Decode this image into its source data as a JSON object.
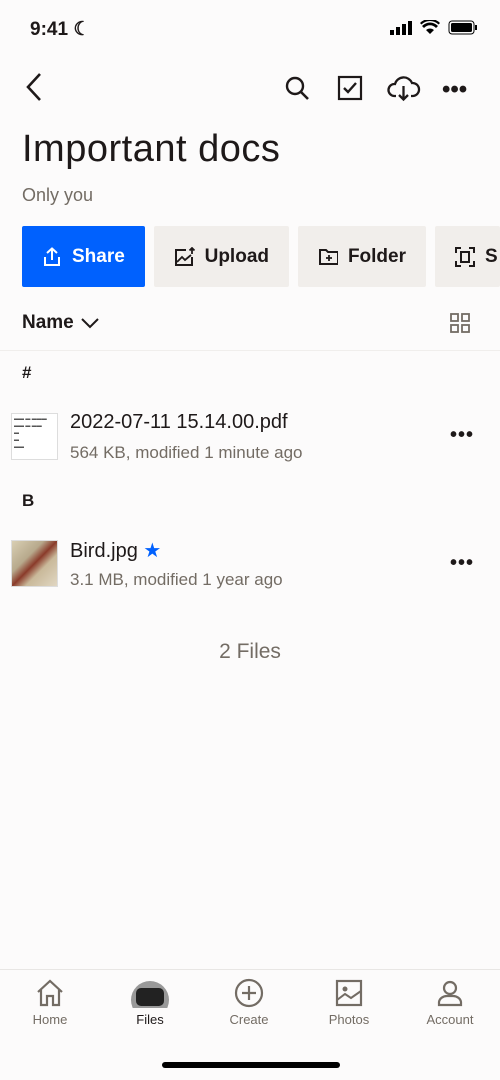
{
  "status": {
    "time": "9:41"
  },
  "header": {
    "title": "Important docs",
    "subtitle": "Only you"
  },
  "actions": [
    {
      "label": "Share"
    },
    {
      "label": "Upload"
    },
    {
      "label": "Folder"
    },
    {
      "label": "S"
    }
  ],
  "sort": {
    "label": "Name"
  },
  "sections": [
    {
      "letter": "#",
      "files": [
        {
          "name": "2022-07-11 15.14.00.pdf",
          "meta": "564 KB, modified 1 minute ago",
          "starred": false
        }
      ]
    },
    {
      "letter": "B",
      "files": [
        {
          "name": "Bird.jpg",
          "meta": "3.1 MB, modified 1 year ago",
          "starred": true
        }
      ]
    }
  ],
  "file_count": "2 Files",
  "tabs": [
    {
      "label": "Home"
    },
    {
      "label": "Files"
    },
    {
      "label": "Create"
    },
    {
      "label": "Photos"
    },
    {
      "label": "Account"
    }
  ],
  "colors": {
    "accent": "#0061fe",
    "star": "#0061fe"
  }
}
